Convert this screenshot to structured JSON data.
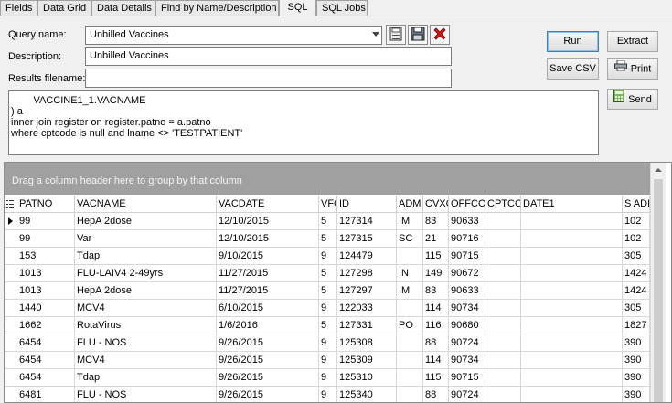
{
  "tabs": [
    "Fields",
    "Data Grid",
    "Data Details",
    "Find by Name/Description",
    "SQL",
    "SQL Jobs"
  ],
  "form": {
    "query_name_label": "Query name:",
    "query_name_value": "Unbilled Vaccines",
    "description_label": "Description:",
    "description_value": "Unbilled Vaccines",
    "results_filename_label": "Results filename:",
    "results_filename_value": ""
  },
  "buttons": {
    "run": "Run",
    "extract": "Extract",
    "save_csv": "Save CSV",
    "print": "Print",
    "send": "Send"
  },
  "icons": [
    "save-icon",
    "save-as-icon",
    "delete-icon",
    "printer-icon",
    "calculator-icon"
  ],
  "sql_text": "        VACCINE1_1.VACNAME\n) a\ninner join register on register.patno = a.patno\nwhere cptcode is null and lname <> 'TESTPATIENT'",
  "grid": {
    "group_prompt": "Drag a column header here to group by that column",
    "columns": [
      "PATNO",
      "VACNAME",
      "VACDATE",
      "VFC",
      "ID",
      "ADM",
      "CVXC",
      "OFFCO",
      "CPTCO",
      "DATE1",
      "S ADD"
    ],
    "rows": [
      [
        "99",
        "HepA 2dose",
        "12/10/2015",
        "5",
        "127314",
        "IM",
        "83",
        "90633",
        "",
        "",
        "102"
      ],
      [
        "99",
        "Var",
        "12/10/2015",
        "5",
        "127315",
        "SC",
        "21",
        "90716",
        "",
        "",
        "102"
      ],
      [
        "153",
        "Tdap",
        "9/10/2015",
        "9",
        "124479",
        "",
        "115",
        "90715",
        "",
        "",
        "305"
      ],
      [
        "1013",
        "FLU-LAIV4 2-49yrs",
        "11/27/2015",
        "5",
        "127298",
        "IN",
        "149",
        "90672",
        "",
        "",
        "1424"
      ],
      [
        "1013",
        "HepA 2dose",
        "11/27/2015",
        "5",
        "127297",
        "IM",
        "83",
        "90633",
        "",
        "",
        "1424"
      ],
      [
        "1440",
        "MCV4",
        "6/10/2015",
        "9",
        "122033",
        "",
        "114",
        "90734",
        "",
        "",
        "305"
      ],
      [
        "1662",
        "RotaVirus",
        "1/6/2016",
        "5",
        "127331",
        "PO",
        "116",
        "90680",
        "",
        "",
        "1827"
      ],
      [
        "6454",
        "FLU - NOS",
        "9/26/2015",
        "9",
        "125308",
        "",
        "88",
        "90724",
        "",
        "",
        "390"
      ],
      [
        "6454",
        "MCV4",
        "9/26/2015",
        "9",
        "125309",
        "",
        "114",
        "90734",
        "",
        "",
        "390"
      ],
      [
        "6454",
        "Tdap",
        "9/26/2015",
        "9",
        "125310",
        "",
        "115",
        "90715",
        "",
        "",
        "390"
      ],
      [
        "6481",
        "FLU - NOS",
        "9/26/2015",
        "9",
        "125340",
        "",
        "88",
        "90724",
        "",
        "",
        "390"
      ]
    ]
  }
}
